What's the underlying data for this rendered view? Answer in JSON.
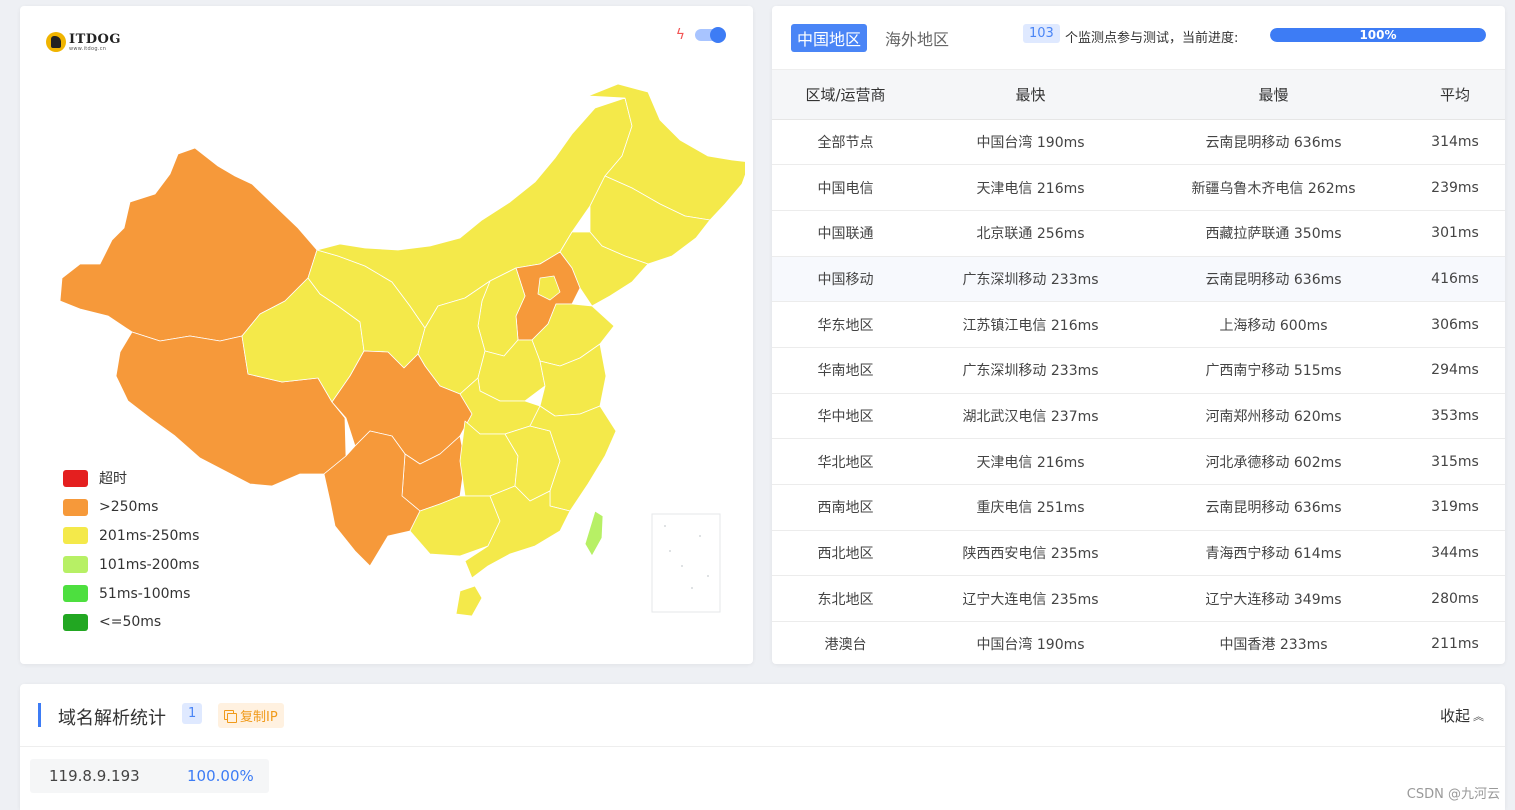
{
  "map_card": {
    "logo": {
      "name": "ITDOG",
      "url": "www.itdog.cn"
    },
    "colors": {
      "high": "#f6993a",
      "mid": "#f4e94a",
      "low": "#b7f065",
      "border": "#ffffff",
      "island_box": "#e5e7ea"
    },
    "legend": [
      {
        "label": "超时",
        "color": "#e41f1f"
      },
      {
        "label": ">250ms",
        "color": "#f6993a"
      },
      {
        "label": "201ms-250ms",
        "color": "#f4e94a"
      },
      {
        "label": "101ms-200ms",
        "color": "#b7f065"
      },
      {
        "label": "51ms-100ms",
        "color": "#4ddf3f"
      },
      {
        "label": "<=50ms",
        "color": "#22a722"
      }
    ]
  },
  "speed_table": {
    "tab_active": "中国地区",
    "tab_inactive": "海外地区",
    "node_count": "103",
    "count_text": "个监测点参与测试，当前进度:",
    "progress_label": "100%",
    "progress_value": 100,
    "headers": [
      "区域/运营商",
      "最快",
      "最慢",
      "平均"
    ],
    "rows": [
      [
        "全部节点",
        "中国台湾 190ms",
        "云南昆明移动 636ms",
        "314ms"
      ],
      [
        "中国电信",
        "天津电信 216ms",
        "新疆乌鲁木齐电信 262ms",
        "239ms"
      ],
      [
        "中国联通",
        "北京联通 256ms",
        "西藏拉萨联通 350ms",
        "301ms"
      ],
      [
        "中国移动",
        "广东深圳移动 233ms",
        "云南昆明移动 636ms",
        "416ms"
      ],
      [
        "华东地区",
        "江苏镇江电信 216ms",
        "上海移动 600ms",
        "306ms"
      ],
      [
        "华南地区",
        "广东深圳移动 233ms",
        "广西南宁移动 515ms",
        "294ms"
      ],
      [
        "华中地区",
        "湖北武汉电信 237ms",
        "河南郑州移动 620ms",
        "353ms"
      ],
      [
        "华北地区",
        "天津电信 216ms",
        "河北承德移动 602ms",
        "315ms"
      ],
      [
        "西南地区",
        "重庆电信 251ms",
        "云南昆明移动 636ms",
        "319ms"
      ],
      [
        "西北地区",
        "陕西西安电信 235ms",
        "青海西宁移动 614ms",
        "344ms"
      ],
      [
        "东北地区",
        "辽宁大连电信 235ms",
        "辽宁大连移动 349ms",
        "280ms"
      ],
      [
        "港澳台",
        "中国台湾 190ms",
        "中国香港 233ms",
        "211ms"
      ]
    ]
  },
  "dns_card": {
    "title": "域名解析统计",
    "count": "1",
    "copy_label": "复制IP",
    "collapse_label": "收起",
    "ips": [
      {
        "ip": "119.8.9.193",
        "pct": "100.00%"
      }
    ]
  },
  "watermark": "CSDN @九河云"
}
